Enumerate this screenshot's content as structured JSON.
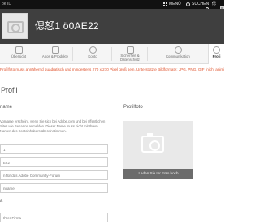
{
  "topbar": {
    "brand": "be ID",
    "menu_label": "MENÜ",
    "search_label": "SUCHEN",
    "user_label": "偲恏1"
  },
  "header": {
    "name": "偲恏1 ö0AE22"
  },
  "tabs": [
    {
      "label": "Übersicht",
      "icon": "grid-icon"
    },
    {
      "label": "Abos & Produkte",
      "icon": "box-icon"
    },
    {
      "label": "Konto",
      "icon": "gear-icon"
    },
    {
      "label": "Sicherheit & Datenschutz",
      "icon": "shield-icon"
    },
    {
      "label": "Kommunikation",
      "icon": "chat-icon"
    },
    {
      "label": "Profi",
      "icon": "user-icon"
    }
  ],
  "notice": "Profilfoto muss annähernd quadratisch und mindestens 270 x 270 Pixel groß sein. Unterstützte Bildformate: JPG, PNG, GIF (nicht animiert). Versuchen Sie es erneut.",
  "profile": {
    "heading": "Profil",
    "name_label": "name",
    "photo_label": "Profilfoto",
    "description": "Vorname erscheint, wenn Sie sich bei Adobe.com und bei öffentlichen Sites wie Behance anmelden. Dieser Name muss nicht mit Ihrem Namen des Kontoinhabers übereinstimmen.",
    "fields": [
      {
        "value": "1"
      },
      {
        "value": "E22"
      },
      {
        "value": "n für das Adobe Community-Forum"
      },
      {
        "value": "nname"
      }
    ],
    "upload_label": "Laden Sie Ihr Foto hoch",
    "company_label": "a",
    "company_field": "Ihrer Firma"
  },
  "colors": {
    "topbar": "#111111",
    "header": "#3f3f3f",
    "notice": "#e0532d",
    "upload_bar": "#6c6c6c"
  }
}
